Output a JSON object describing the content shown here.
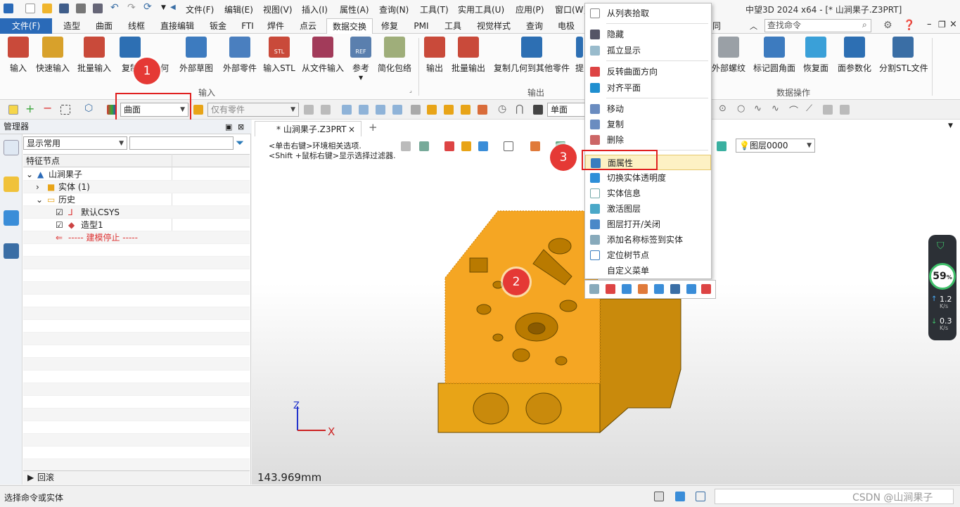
{
  "titlebar": {
    "menus": [
      "文件(F)",
      "编辑(E)",
      "视图(V)",
      "插入(I)",
      "属性(A)",
      "查询(N)",
      "工具(T)",
      "实用工具(U)",
      "应用(P)",
      "窗口(W)"
    ],
    "title": "中望3D 2024 x64 - [* 山涧果子.Z3PRT]"
  },
  "tabs": {
    "items": [
      "文件(F)",
      "造型",
      "曲面",
      "线框",
      "直接编辑",
      "钣金",
      "FTI",
      "焊件",
      "点云",
      "数据交换",
      "修复",
      "PMI",
      "工具",
      "视觉样式",
      "查询",
      "电极"
    ],
    "tail": "同",
    "search_placeholder": "查找命令"
  },
  "ribbon": {
    "input_buttons": [
      "输入",
      "快速输入",
      "批量输入",
      "复制",
      "何",
      "外部草图",
      "外部零件",
      "输入STL",
      "从文件输入",
      "参考",
      "简化包络"
    ],
    "output_buttons": [
      "输出",
      "批量输出",
      "复制几何到其他零件",
      "提"
    ],
    "data_buttons": [
      "外部螺纹",
      "标记圆角面",
      "恢复面",
      "面参数化",
      "分割STL文件"
    ],
    "group_input": "输入",
    "group_output": "输出",
    "group_data": "数据操作",
    "ref_tag": "REF",
    "stl_tag": "STL"
  },
  "toolbar2": {
    "filter_value": "曲面",
    "part_filter": "仅有零件",
    "face_mode": "单面",
    "layer": "图层0000"
  },
  "manager": {
    "title": "管理器",
    "filter": "显示常用",
    "column": "特征节点",
    "tree": {
      "root": "山涧果子",
      "solid": "实体 (1)",
      "history": "历史",
      "csys": "默认CSYS",
      "shape": "造型1",
      "stop": "----- 建模停止 -----"
    },
    "rollback": "回滚"
  },
  "viewport": {
    "tab_label": "* 山涧果子.Z3PRT",
    "hint_line1": "<单击右键>环境相关选项.",
    "hint_line2": "<Shift +鼠标右键>显示选择过滤器.",
    "measure": "143.969mm",
    "axis_x": "X",
    "axis_z": "Z"
  },
  "context_menu": {
    "items": [
      "从列表拾取",
      "隐藏",
      "孤立显示",
      "反转曲面方向",
      "对齐平面",
      "移动",
      "复制",
      "删除",
      "面属性",
      "切换实体透明度",
      "实体信息",
      "激活图层",
      "图层打开/关闭",
      "添加名称标签到实体",
      "定位树节点",
      "自定义菜单"
    ],
    "highlighted": "面属性"
  },
  "badges": [
    "1",
    "2",
    "3"
  ],
  "gauge": {
    "percent": "59",
    "unit": "%",
    "up": "1.2",
    "up_unit": "K/s",
    "down": "0.3",
    "down_unit": "K/s"
  },
  "status": {
    "text": "选择命令或实体",
    "watermark": "CSDN @山涧果子"
  },
  "colors": {
    "accent": "#2a6ab8",
    "part": "#e8a417",
    "selected_face": "#f5a623",
    "badge": "#e53935"
  }
}
